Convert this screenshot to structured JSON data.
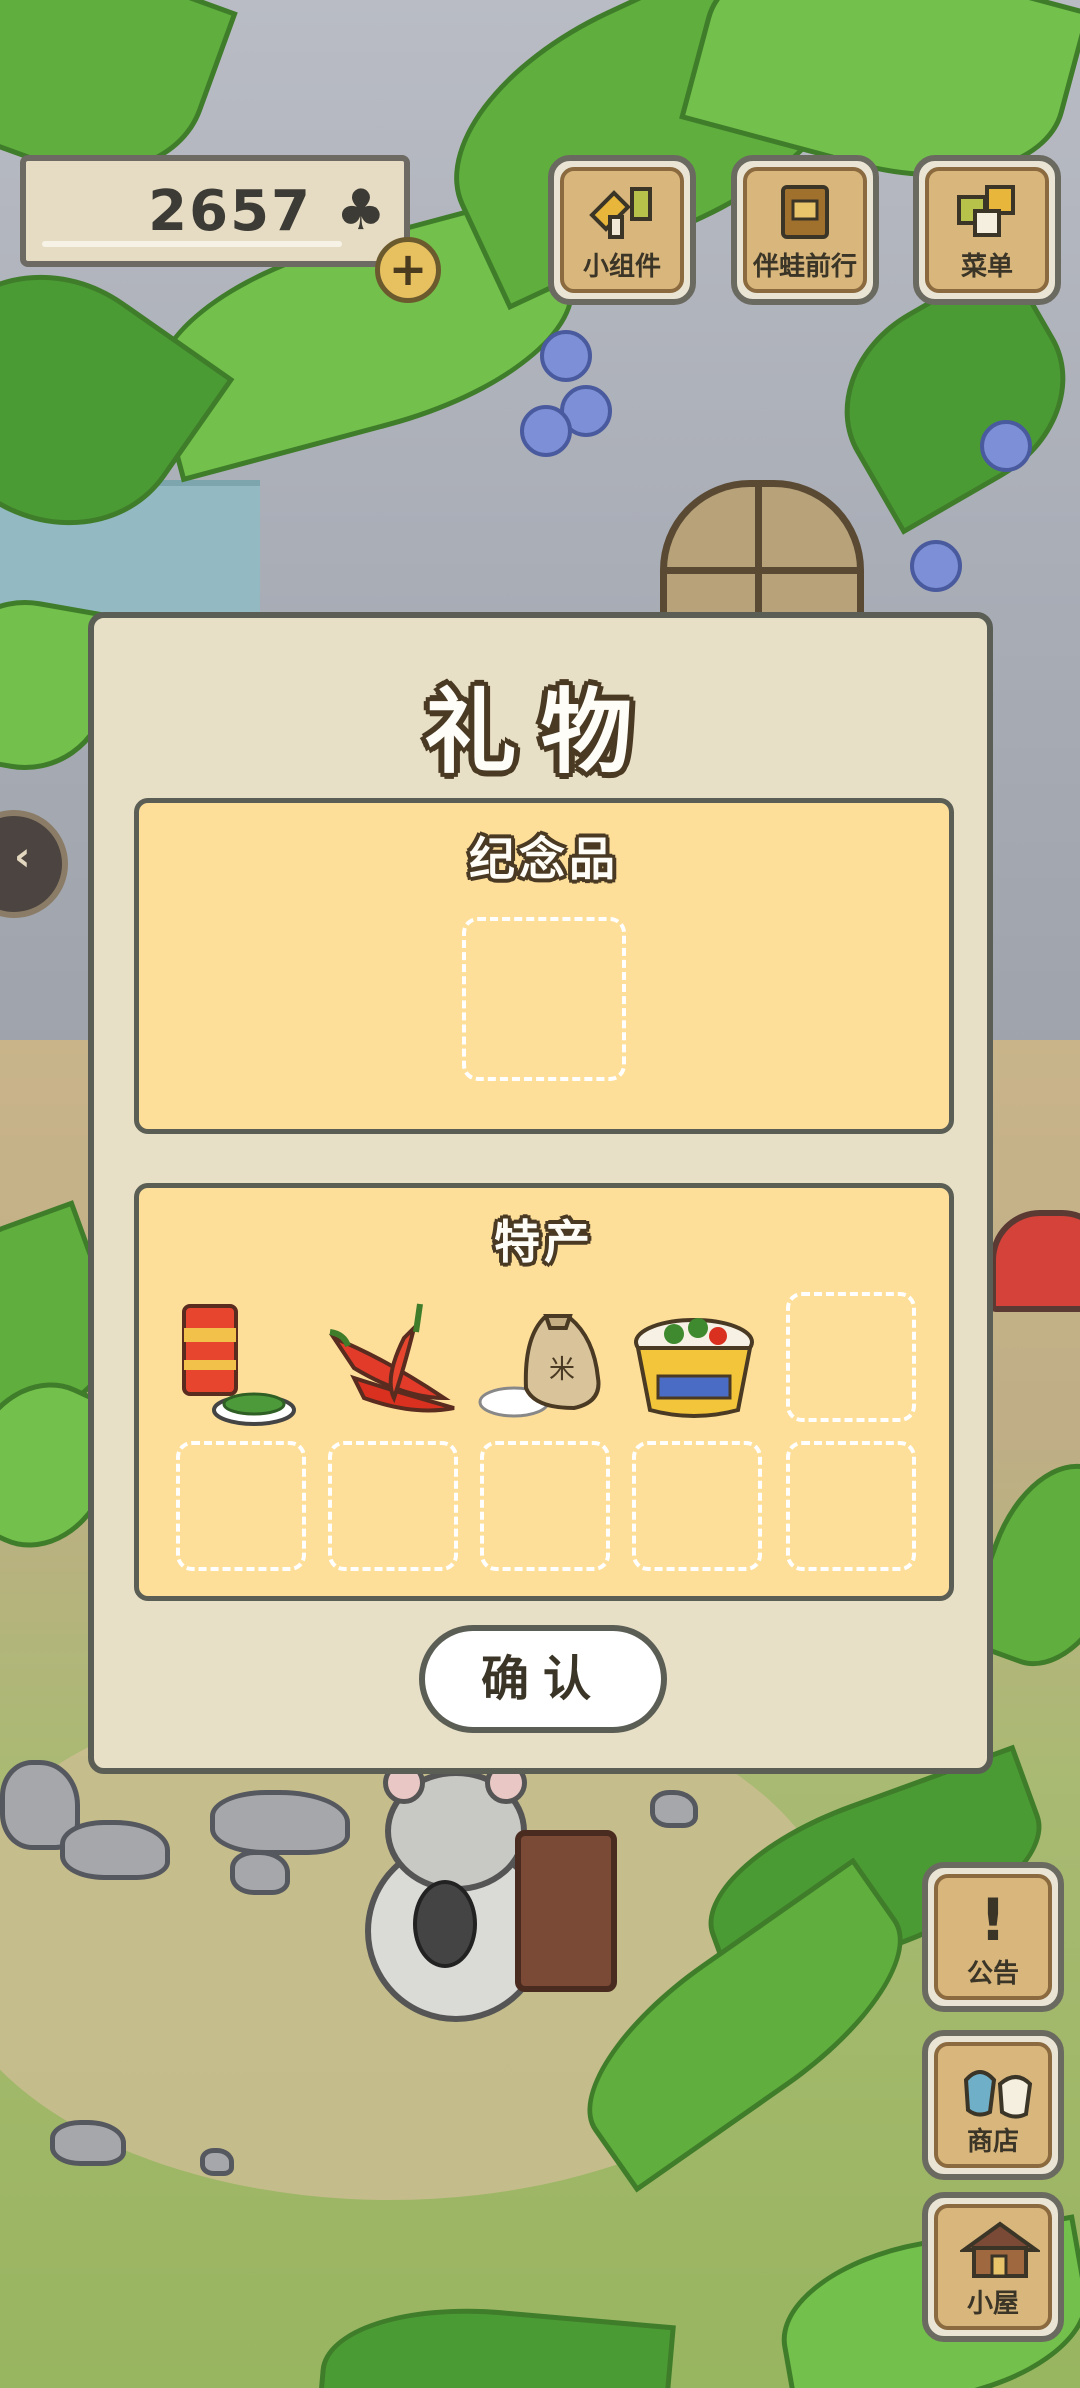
{
  "hud": {
    "currency_value": "2657",
    "currency_icon": "clover-icon",
    "plus_icon": "+",
    "buttons": [
      {
        "label": "小组件",
        "icon": "widget-icon"
      },
      {
        "label": "伴蛙前行",
        "icon": "journal-icon"
      },
      {
        "label": "菜单",
        "icon": "menu-icon"
      }
    ],
    "side_buttons": [
      {
        "label": "公告",
        "glyph": "!",
        "icon": "notice-icon"
      },
      {
        "label": "商店",
        "glyph": "",
        "icon": "shop-icon"
      },
      {
        "label": "小屋",
        "glyph": "",
        "icon": "house-icon"
      }
    ]
  },
  "dialog": {
    "title": "礼物",
    "souvenir": {
      "title": "纪念品",
      "slots": 1
    },
    "specialty": {
      "title": "特产",
      "items": [
        "tea-can-and-greens-icon",
        "chili-peppers-icon",
        "rice-sack-icon",
        "noodle-bowl-icon"
      ],
      "empty_slots": 6
    },
    "confirm_label": "确认"
  },
  "colors": {
    "panel_fill": "#fedf9a",
    "dialog_fill": "#e8e0c6",
    "border": "#5b5e55",
    "button_wood": "#d9b77c"
  }
}
